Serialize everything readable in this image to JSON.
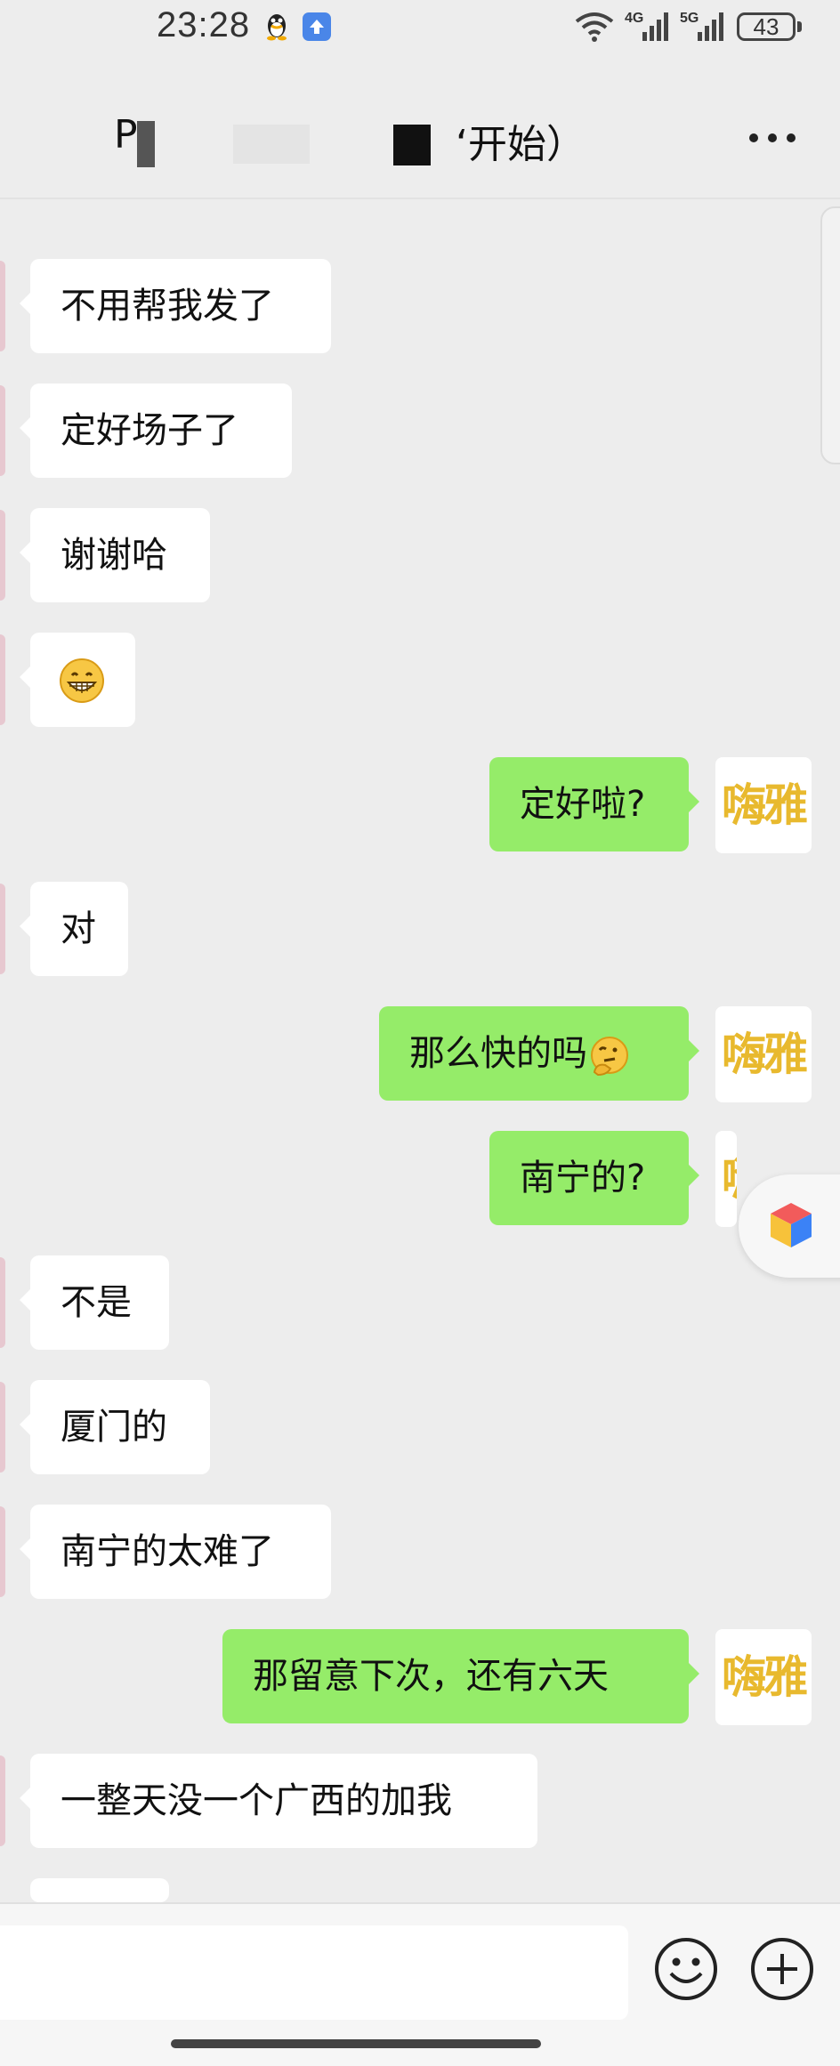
{
  "status_bar": {
    "time": "23:28",
    "net1": "4G",
    "net2": "5G",
    "battery": "43"
  },
  "header": {
    "title_start": "P",
    "title_end": "‘开始）"
  },
  "messages": [
    {
      "side": "left",
      "text": "不用帮我发了"
    },
    {
      "side": "left",
      "text": "定好场子了"
    },
    {
      "side": "left",
      "text": "谢谢哈"
    },
    {
      "side": "left",
      "emoji": "grinning-face-emoji"
    },
    {
      "side": "right",
      "text": "定好啦?"
    },
    {
      "side": "left",
      "text": "对"
    },
    {
      "side": "right",
      "text": "那么快的吗",
      "emoji": "thinking-face-emoji"
    },
    {
      "side": "right",
      "text": "南宁的?"
    },
    {
      "side": "left",
      "text": "不是"
    },
    {
      "side": "left",
      "text": "厦门的"
    },
    {
      "side": "left",
      "text": "南宁的太难了"
    },
    {
      "side": "right",
      "text": "那留意下次，还有六天"
    },
    {
      "side": "left",
      "text": "一整天没一个广西的加我"
    }
  ],
  "my_avatar_text": "嗨雅",
  "input_bar": {
    "icons": [
      "emoji-icon",
      "plus-icon"
    ]
  },
  "colors": {
    "background": "#ededed",
    "my_bubble": "#95ec69",
    "their_bubble": "#ffffff",
    "avatar_text": "#e8b92e"
  }
}
